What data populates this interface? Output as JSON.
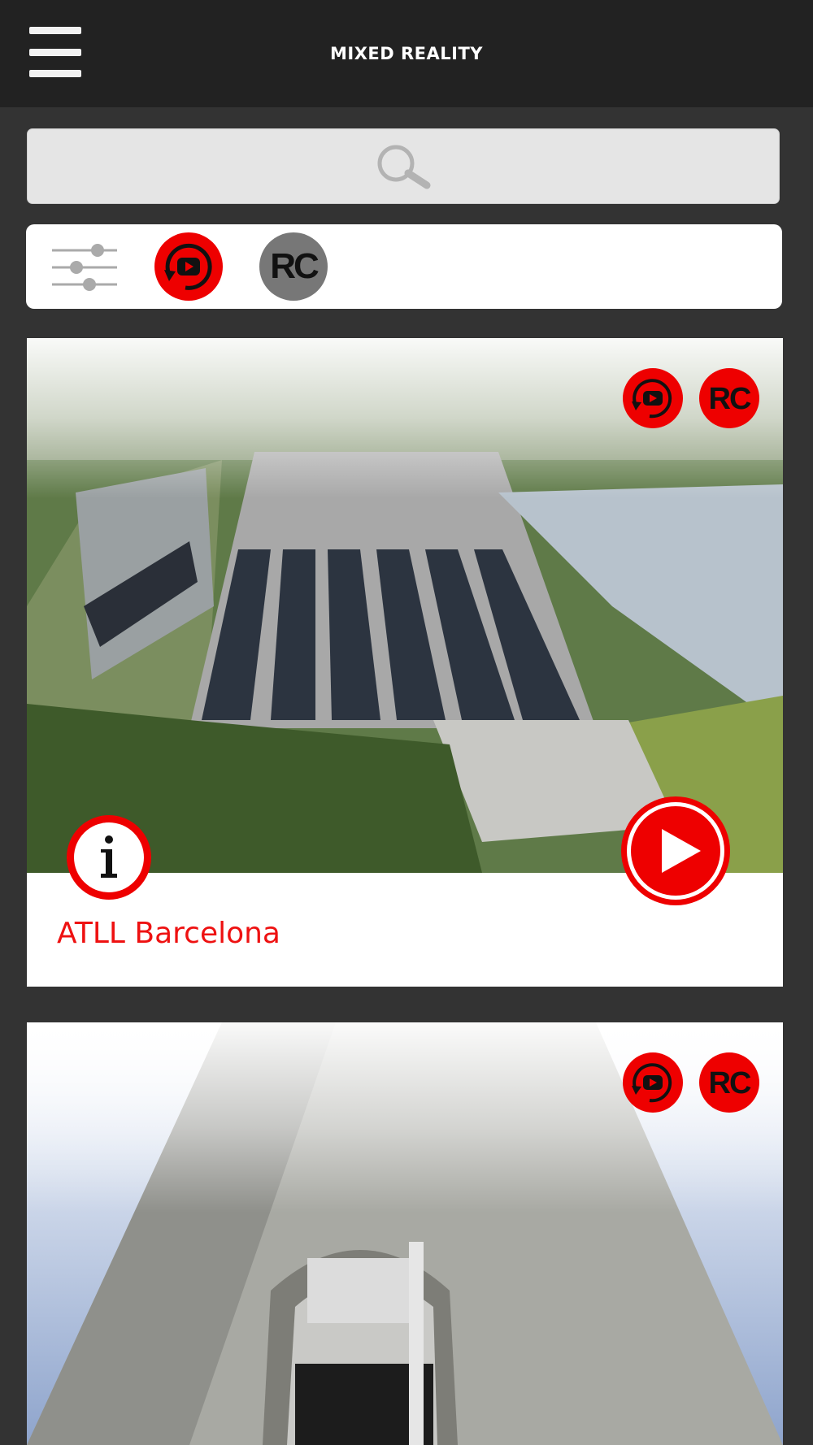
{
  "header": {
    "title": "MIXED REALITY",
    "menu_icon": "hamburger-icon"
  },
  "search": {
    "icon": "search-icon"
  },
  "filters": {
    "settings_icon": "sliders-icon",
    "youtube_icon": "video-replay-icon",
    "rc_label": "RC"
  },
  "cards": [
    {
      "title": "ATLL Barcelona",
      "badge_rc": "RC"
    },
    {
      "title": "",
      "badge_rc": "RC"
    }
  ],
  "colors": {
    "accent": "#ee1111",
    "topbar": "#222222",
    "background": "#333333",
    "rc_gray": "#777777"
  }
}
